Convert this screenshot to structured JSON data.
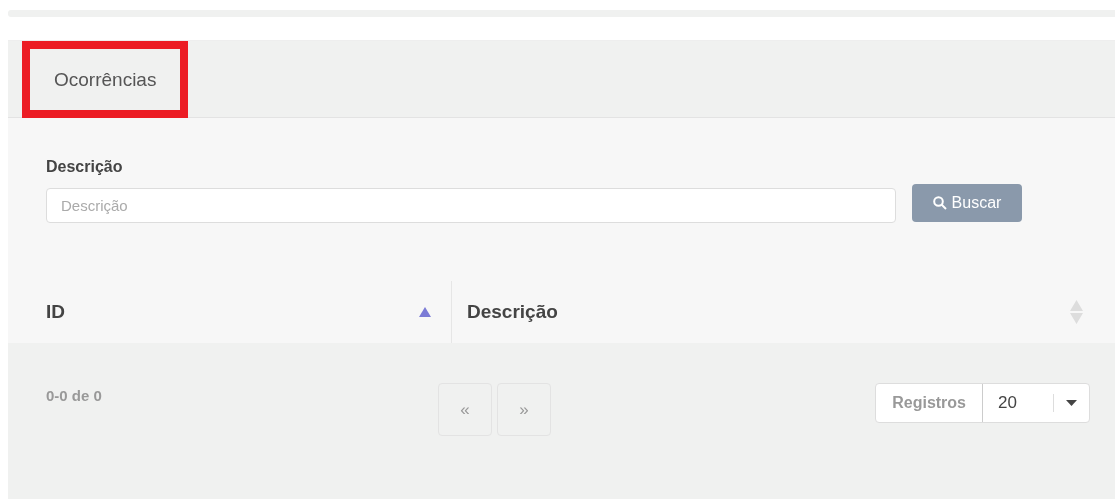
{
  "panel": {
    "title": "Ocorrências",
    "highlighted": true
  },
  "filter": {
    "label": "Descrição",
    "placeholder": "Descrição",
    "button": "Buscar"
  },
  "table": {
    "columns": [
      {
        "label": "ID",
        "sorted": true
      },
      {
        "label": "Descrição",
        "sorted": false
      }
    ]
  },
  "footer": {
    "range": "0-0 de 0",
    "pager": [
      {
        "label": "«",
        "disabled": true
      },
      {
        "label": "»",
        "disabled": true
      }
    ],
    "page_size_label": "Registros",
    "page_size": "20"
  }
}
